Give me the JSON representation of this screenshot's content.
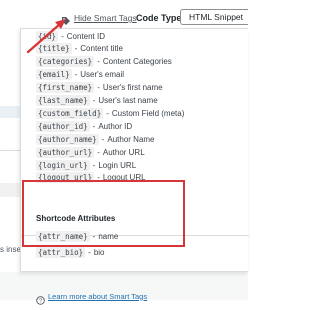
{
  "toolbar": {
    "hide_smart_tags_label": "Hide Smart Tags",
    "code_type_label": "Code Type",
    "code_type_value": "HTML Snippet"
  },
  "smart_tags": [
    {
      "tag": "{id}",
      "description": "Content ID"
    },
    {
      "tag": "{title}",
      "description": "Content title"
    },
    {
      "tag": "{categories}",
      "description": "Content Categories"
    },
    {
      "tag": "{email}",
      "description": "User's email"
    },
    {
      "tag": "{first_name}",
      "description": "User's first name"
    },
    {
      "tag": "{last_name}",
      "description": "User's last name"
    },
    {
      "tag": "{custom_field}",
      "description": "Custom Field (meta)"
    },
    {
      "tag": "{author_id}",
      "description": "Author ID"
    },
    {
      "tag": "{author_name}",
      "description": "Author Name"
    },
    {
      "tag": "{author_url}",
      "description": "Author URL"
    },
    {
      "tag": "{login_url}",
      "description": "Login URL"
    },
    {
      "tag": "{logout_url}",
      "description": "Logout URL"
    }
  ],
  "shortcode_section": {
    "heading": "Shortcode Attributes",
    "items": [
      {
        "tag": "{attr_name}",
        "description": "name"
      },
      {
        "tag": "{attr_bio}",
        "description": "bio"
      }
    ]
  },
  "learn_more_label": "Learn more about Smart Tags",
  "background_text": "s inserted",
  "colors": {
    "annotation_red": "#d63638",
    "link_blue": "#2271b1",
    "tag_background": "#f0f0f1"
  },
  "icons": {
    "hide_tags": "tag-icon",
    "learn_more": "help-icon"
  }
}
